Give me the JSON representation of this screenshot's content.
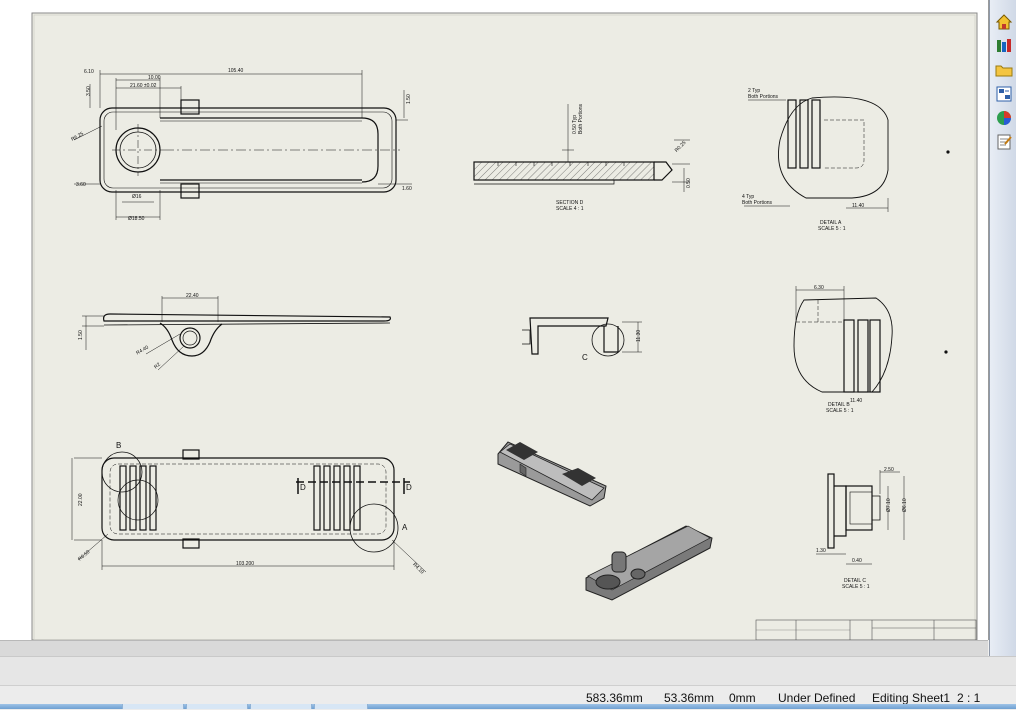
{
  "drawing": {
    "dims": {
      "top_left_1": "6.10",
      "top_width": "105.40",
      "top_inner_1": "10.00",
      "top_inner_2": "21.60 ±0.02",
      "top_left_v": "3.50",
      "top_right_v": "1.50",
      "top_radius": "R6.25",
      "top_low_left": "3.60",
      "top_low_right": "1.60",
      "top_hole_small": "Ø16",
      "top_hole_big": "Ø18.50",
      "side_width": "22.40",
      "side_left": "1.50",
      "side_r1": "R4.40",
      "side_r2": "R2",
      "bottom_height": "22.00",
      "bottom_width": "103.200",
      "bottom_radius": "R6.50",
      "bottom_right": "R4.10",
      "section_dim_1": "0.50 Typ",
      "section_dim_2": "Both Portions",
      "section_right_1": "R0.25",
      "section_right_2": "0.50",
      "detail_a_t1": "2 Typ",
      "detail_a_t2": "Both Portions",
      "detail_a_b1": "4 Typ",
      "detail_a_b2": "Both Portions",
      "detail_a_dim": "11.40",
      "detail_b_dim1": "6.30",
      "detail_b_dim2": "11.40",
      "c_dim": "11.30",
      "detail_c_d1": "2.50",
      "detail_c_d2": "Ø7.10",
      "detail_c_d3": "Ø6.10",
      "detail_c_d4": "1.30",
      "detail_c_d5": "0.40"
    },
    "labels": {
      "section_title": "SECTION D",
      "section_scale": "SCALE 4 : 1",
      "detail_a_title": "DETAIL A",
      "detail_a_scale": "SCALE 5 : 1",
      "detail_b_title": "DETAIL B",
      "detail_b_scale": "SCALE 5 : 1",
      "detail_c_title": "DETAIL C",
      "detail_c_scale": "SCALE 5 : 1",
      "callout_a": "A",
      "callout_b": "B",
      "callout_c": "C",
      "callout_d1": "D",
      "callout_d2": "D"
    }
  },
  "task_pane": {
    "icons": [
      "home-icon",
      "design-library-icon",
      "file-explorer-icon",
      "view-palette-icon",
      "appearances-icon",
      "custom-properties-icon"
    ]
  },
  "status_bar": {
    "x": "583.36mm",
    "y": "53.36mm",
    "z": "0mm",
    "state": "Under Defined",
    "editing": "Editing Sheet1",
    "scale": "2 : 1"
  }
}
